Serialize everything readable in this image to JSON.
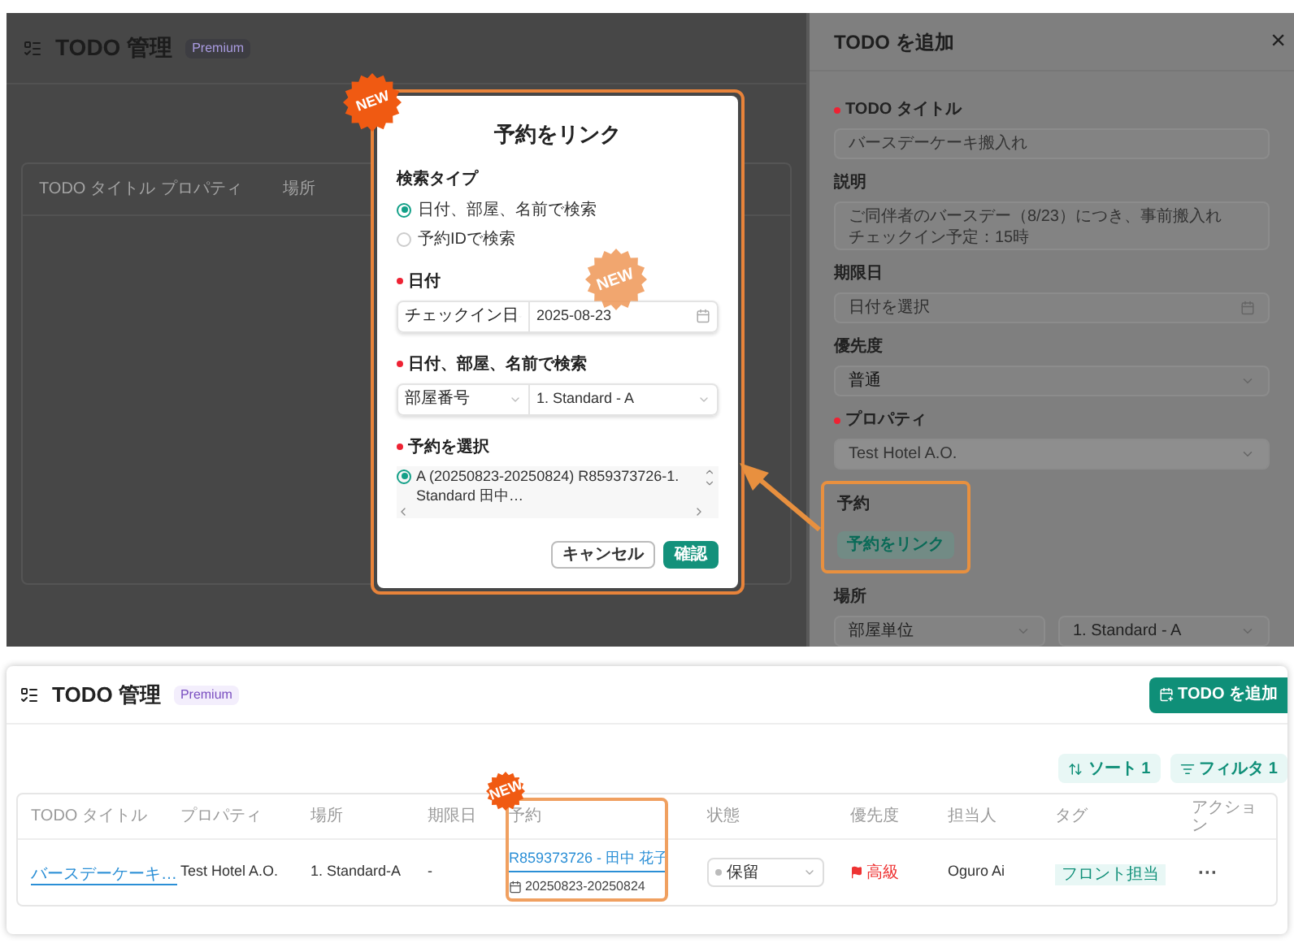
{
  "background_app": {
    "title": "TODO 管理",
    "badge": "Premium",
    "columns": [
      "TODO タイトル",
      "プロパティ",
      "場所"
    ]
  },
  "link_dialog": {
    "title": "予約をリンク",
    "new_badge": "NEW",
    "search_type": {
      "label": "検索タイプ",
      "options": [
        {
          "label": "日付、部屋、名前で検索",
          "selected": true
        },
        {
          "label": "予約IDで検索",
          "selected": false
        }
      ]
    },
    "date": {
      "label": "日付",
      "required": true,
      "type_select": "チェックイン日",
      "value": "2025-08-23",
      "new_badge": "NEW"
    },
    "room": {
      "label": "日付、部屋、名前で検索",
      "required": true,
      "type_select": "部屋番号",
      "value": "1. Standard - A"
    },
    "reservation": {
      "label": "予約を選択",
      "required": true,
      "options": [
        {
          "label": "A (20250823-20250824) R859373726-1. Standard 田中…",
          "selected": true
        }
      ]
    },
    "buttons": [
      {
        "label": "キャンセル",
        "kind": "secondary"
      },
      {
        "label": "確認",
        "kind": "primary"
      }
    ]
  },
  "drawer": {
    "title": "TODO を追加",
    "close": "×",
    "fields": [
      {
        "kind": "input",
        "label": "TODO タイトル",
        "required": true,
        "value": "バースデーケーキ搬入れ"
      },
      {
        "kind": "textarea",
        "label": "説明",
        "required": false,
        "lines": [
          "ご同伴者のバースデー（8/23）につき、事前搬入れ",
          "チェックイン予定：15時"
        ]
      },
      {
        "kind": "date",
        "label": "期限日",
        "required": false,
        "placeholder": "日付を選択"
      },
      {
        "kind": "select",
        "label": "優先度",
        "required": false,
        "value": "普通",
        "disabled": false
      },
      {
        "kind": "select",
        "label": "プロパティ",
        "required": true,
        "value": "Test Hotel A.O.",
        "disabled": true
      },
      {
        "kind": "link",
        "label": "予約",
        "required": false,
        "button": "予約をリンク",
        "highlighted": true
      },
      {
        "kind": "select_pair",
        "label": "場所",
        "required": false,
        "values": [
          "部屋単位",
          "1. Standard - A"
        ]
      }
    ]
  },
  "main_app": {
    "title": "TODO 管理",
    "badge": "Premium",
    "add_button": "TODO を追加",
    "toolbar": [
      {
        "kind": "sort",
        "label": "ソート 1"
      },
      {
        "kind": "filter",
        "label": "フィルタ 1"
      }
    ],
    "columns": [
      "TODO タイトル",
      "プロパティ",
      "場所",
      "期限日",
      "予約",
      "状態",
      "優先度",
      "担当人",
      "タグ",
      "アクション"
    ],
    "new_badge": "NEW",
    "rows": [
      {
        "title": "バースデーケーキ…",
        "property": "Test Hotel A.O.",
        "location": "1. Standard-A",
        "due": "-",
        "reservation": {
          "link": "R859373726 - 田中 花子",
          "dates": "20250823-20250824"
        },
        "status": "保留",
        "priority": "高級",
        "assignee": "Oguro Ai",
        "tag": "フロント担当",
        "actions": "···"
      }
    ]
  }
}
